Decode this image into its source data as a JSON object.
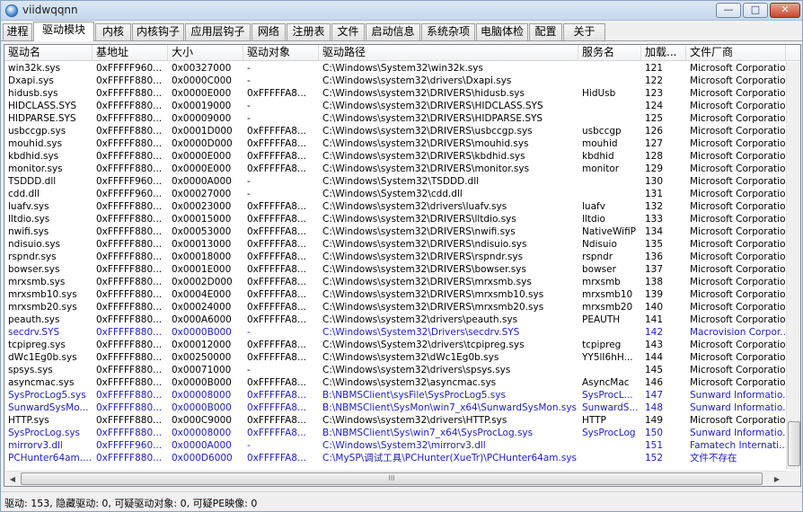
{
  "window": {
    "title": "viidwqqnn",
    "minimize": "—",
    "maximize": "□",
    "close": "✕"
  },
  "tabs": [
    "进程",
    "驱动模块",
    "内核",
    "内核钩子",
    "应用层钩子",
    "网络",
    "注册表",
    "文件",
    "启动信息",
    "系统杂项",
    "电脑体检",
    "配置",
    "关于"
  ],
  "active_tab": "驱动模块",
  "columns": [
    "驱动名",
    "基地址",
    "大小",
    "驱动对象",
    "驱动路径",
    "服务名",
    "加载...",
    "文件厂商"
  ],
  "rows": [
    {
      "name": "win32k.sys",
      "base": "0xFFFFF960...",
      "size": "0x00327000",
      "obj": "-",
      "path": "C:\\Windows\\System32\\win32k.sys",
      "svc": "",
      "order": "121",
      "vendor": "Microsoft Corporation",
      "blue": false
    },
    {
      "name": "Dxapi.sys",
      "base": "0xFFFFF880...",
      "size": "0x0000C000",
      "obj": "-",
      "path": "C:\\Windows\\system32\\drivers\\Dxapi.sys",
      "svc": "",
      "order": "122",
      "vendor": "Microsoft Corporation",
      "blue": false
    },
    {
      "name": "hidusb.sys",
      "base": "0xFFFFF880...",
      "size": "0x0000E000",
      "obj": "0xFFFFFA8...",
      "path": "C:\\Windows\\system32\\DRIVERS\\hidusb.sys",
      "svc": "HidUsb",
      "order": "123",
      "vendor": "Microsoft Corporation",
      "blue": false
    },
    {
      "name": "HIDCLASS.SYS",
      "base": "0xFFFFF880...",
      "size": "0x00019000",
      "obj": "-",
      "path": "C:\\Windows\\system32\\DRIVERS\\HIDCLASS.SYS",
      "svc": "",
      "order": "124",
      "vendor": "Microsoft Corporation",
      "blue": false
    },
    {
      "name": "HIDPARSE.SYS",
      "base": "0xFFFFF880...",
      "size": "0x00009000",
      "obj": "-",
      "path": "C:\\Windows\\system32\\DRIVERS\\HIDPARSE.SYS",
      "svc": "",
      "order": "125",
      "vendor": "Microsoft Corporation",
      "blue": false
    },
    {
      "name": "usbccgp.sys",
      "base": "0xFFFFF880...",
      "size": "0x0001D000",
      "obj": "0xFFFFFA8...",
      "path": "C:\\Windows\\system32\\DRIVERS\\usbccgp.sys",
      "svc": "usbccgp",
      "order": "126",
      "vendor": "Microsoft Corporation",
      "blue": false
    },
    {
      "name": "mouhid.sys",
      "base": "0xFFFFF880...",
      "size": "0x0000D000",
      "obj": "0xFFFFFA8...",
      "path": "C:\\Windows\\system32\\DRIVERS\\mouhid.sys",
      "svc": "mouhid",
      "order": "127",
      "vendor": "Microsoft Corporation",
      "blue": false
    },
    {
      "name": "kbdhid.sys",
      "base": "0xFFFFF880...",
      "size": "0x0000E000",
      "obj": "0xFFFFFA8...",
      "path": "C:\\Windows\\system32\\DRIVERS\\kbdhid.sys",
      "svc": "kbdhid",
      "order": "128",
      "vendor": "Microsoft Corporation",
      "blue": false
    },
    {
      "name": "monitor.sys",
      "base": "0xFFFFF880...",
      "size": "0x0000E000",
      "obj": "0xFFFFFA8...",
      "path": "C:\\Windows\\system32\\DRIVERS\\monitor.sys",
      "svc": "monitor",
      "order": "129",
      "vendor": "Microsoft Corporation",
      "blue": false
    },
    {
      "name": "TSDDD.dll",
      "base": "0xFFFFF960...",
      "size": "0x0000A000",
      "obj": "-",
      "path": "C:\\Windows\\System32\\TSDDD.dll",
      "svc": "",
      "order": "130",
      "vendor": "Microsoft Corporation",
      "blue": false
    },
    {
      "name": "cdd.dll",
      "base": "0xFFFFF960...",
      "size": "0x00027000",
      "obj": "-",
      "path": "C:\\Windows\\System32\\cdd.dll",
      "svc": "",
      "order": "131",
      "vendor": "Microsoft Corporation",
      "blue": false
    },
    {
      "name": "luafv.sys",
      "base": "0xFFFFF880...",
      "size": "0x00023000",
      "obj": "0xFFFFFA8...",
      "path": "C:\\Windows\\system32\\drivers\\luafv.sys",
      "svc": "luafv",
      "order": "132",
      "vendor": "Microsoft Corporation",
      "blue": false
    },
    {
      "name": "lltdio.sys",
      "base": "0xFFFFF880...",
      "size": "0x00015000",
      "obj": "0xFFFFFA8...",
      "path": "C:\\Windows\\system32\\DRIVERS\\lltdio.sys",
      "svc": "lltdio",
      "order": "133",
      "vendor": "Microsoft Corporation",
      "blue": false
    },
    {
      "name": "nwifi.sys",
      "base": "0xFFFFF880...",
      "size": "0x00053000",
      "obj": "0xFFFFFA8...",
      "path": "C:\\Windows\\system32\\DRIVERS\\nwifi.sys",
      "svc": "NativeWifiP",
      "order": "134",
      "vendor": "Microsoft Corporation",
      "blue": false
    },
    {
      "name": "ndisuio.sys",
      "base": "0xFFFFF880...",
      "size": "0x00013000",
      "obj": "0xFFFFFA8...",
      "path": "C:\\Windows\\system32\\DRIVERS\\ndisuio.sys",
      "svc": "Ndisuio",
      "order": "135",
      "vendor": "Microsoft Corporation",
      "blue": false
    },
    {
      "name": "rspndr.sys",
      "base": "0xFFFFF880...",
      "size": "0x00018000",
      "obj": "0xFFFFFA8...",
      "path": "C:\\Windows\\system32\\DRIVERS\\rspndr.sys",
      "svc": "rspndr",
      "order": "136",
      "vendor": "Microsoft Corporation",
      "blue": false
    },
    {
      "name": "bowser.sys",
      "base": "0xFFFFF880...",
      "size": "0x0001E000",
      "obj": "0xFFFFFA8...",
      "path": "C:\\Windows\\system32\\DRIVERS\\bowser.sys",
      "svc": "bowser",
      "order": "137",
      "vendor": "Microsoft Corporation",
      "blue": false
    },
    {
      "name": "mrxsmb.sys",
      "base": "0xFFFFF880...",
      "size": "0x0002D000",
      "obj": "0xFFFFFA8...",
      "path": "C:\\Windows\\system32\\DRIVERS\\mrxsmb.sys",
      "svc": "mrxsmb",
      "order": "138",
      "vendor": "Microsoft Corporation",
      "blue": false
    },
    {
      "name": "mrxsmb10.sys",
      "base": "0xFFFFF880...",
      "size": "0x0004E000",
      "obj": "0xFFFFFA8...",
      "path": "C:\\Windows\\system32\\DRIVERS\\mrxsmb10.sys",
      "svc": "mrxsmb10",
      "order": "139",
      "vendor": "Microsoft Corporation",
      "blue": false
    },
    {
      "name": "mrxsmb20.sys",
      "base": "0xFFFFF880...",
      "size": "0x00024000",
      "obj": "0xFFFFFA8...",
      "path": "C:\\Windows\\system32\\DRIVERS\\mrxsmb20.sys",
      "svc": "mrxsmb20",
      "order": "140",
      "vendor": "Microsoft Corporation",
      "blue": false
    },
    {
      "name": "peauth.sys",
      "base": "0xFFFFF880...",
      "size": "0x000A6000",
      "obj": "0xFFFFFA8...",
      "path": "C:\\Windows\\system32\\drivers\\peauth.sys",
      "svc": "PEAUTH",
      "order": "141",
      "vendor": "Microsoft Corporation",
      "blue": false
    },
    {
      "name": "secdrv.SYS",
      "base": "0xFFFFF880...",
      "size": "0x0000B000",
      "obj": "-",
      "path": "C:\\Windows\\System32\\Drivers\\secdrv.SYS",
      "svc": "",
      "order": "142",
      "vendor": "Macrovision Corpor...",
      "blue": true
    },
    {
      "name": "tcpipreg.sys",
      "base": "0xFFFFF880...",
      "size": "0x00012000",
      "obj": "0xFFFFFA8...",
      "path": "C:\\Windows\\System32\\drivers\\tcpipreg.sys",
      "svc": "tcpipreg",
      "order": "143",
      "vendor": "Microsoft Corporation",
      "blue": false
    },
    {
      "name": "dWc1Eg0b.sys",
      "base": "0xFFFFF880...",
      "size": "0x00250000",
      "obj": "0xFFFFFA8...",
      "path": "C:\\Windows\\system32\\dWc1Eg0b.sys",
      "svc": "YY5lI6hH...",
      "order": "144",
      "vendor": "Microsoft Corporation",
      "blue": false
    },
    {
      "name": "spsys.sys",
      "base": "0xFFFFF880...",
      "size": "0x00071000",
      "obj": "-",
      "path": "C:\\Windows\\system32\\drivers\\spsys.sys",
      "svc": "",
      "order": "145",
      "vendor": "Microsoft Corporation",
      "blue": false
    },
    {
      "name": "asyncmac.sys",
      "base": "0xFFFFF880...",
      "size": "0x0000B000",
      "obj": "0xFFFFFA8...",
      "path": "C:\\Windows\\system32\\asyncmac.sys",
      "svc": "AsyncMac",
      "order": "146",
      "vendor": "Microsoft Corporation",
      "blue": false
    },
    {
      "name": "SysProcLog5.sys",
      "base": "0xFFFFF880...",
      "size": "0x00008000",
      "obj": "0xFFFFFA8...",
      "path": "B:\\NBMSClient\\sysFile\\SysProcLog5.sys",
      "svc": "SysProcL...",
      "order": "147",
      "vendor": "Sunward Informatio...",
      "blue": true
    },
    {
      "name": "SunwardSysMo...",
      "base": "0xFFFFF880...",
      "size": "0x0000B000",
      "obj": "0xFFFFFA8...",
      "path": "B:\\NBMSClient\\SysMon\\win7_x64\\SunwardSysMon.sys",
      "svc": "SunwardS...",
      "order": "148",
      "vendor": "Sunward Informatio...",
      "blue": true
    },
    {
      "name": "HTTP.sys",
      "base": "0xFFFFF880...",
      "size": "0x000C9000",
      "obj": "0xFFFFFA8...",
      "path": "C:\\Windows\\system32\\drivers\\HTTP.sys",
      "svc": "HTTP",
      "order": "149",
      "vendor": "Microsoft Corporation",
      "blue": false
    },
    {
      "name": "SysProcLog.sys",
      "base": "0xFFFFF880...",
      "size": "0x00008000",
      "obj": "0xFFFFFA8...",
      "path": "B:\\NBMSClient\\Sys\\win7_x64\\SysProcLog.sys",
      "svc": "SysProcLog",
      "order": "150",
      "vendor": "Sunward Informatio...",
      "blue": true
    },
    {
      "name": "mirrorv3.dll",
      "base": "0xFFFFF960...",
      "size": "0x0000A000",
      "obj": "-",
      "path": "C:\\Windows\\System32\\mirrorv3.dll",
      "svc": "",
      "order": "151",
      "vendor": "Famatech Internati...",
      "blue": true
    },
    {
      "name": "PCHunter64am....",
      "base": "0xFFFFF880...",
      "size": "0x000D6000",
      "obj": "0xFFFFFA8...",
      "path": "C:\\MySP\\调试工具\\PCHunter(XueTr)\\PCHunter64am.sys",
      "svc": "",
      "order": "152",
      "vendor": "文件不存在",
      "blue": true
    }
  ],
  "scroll": {
    "h_thumb_grip": "III",
    "left_arrow": "◀",
    "right_arrow": "▶"
  },
  "status": {
    "text": "驱动: 153, 隐藏驱动: 0, 可疑驱动对象: 0, 可疑PE映像: 0"
  }
}
